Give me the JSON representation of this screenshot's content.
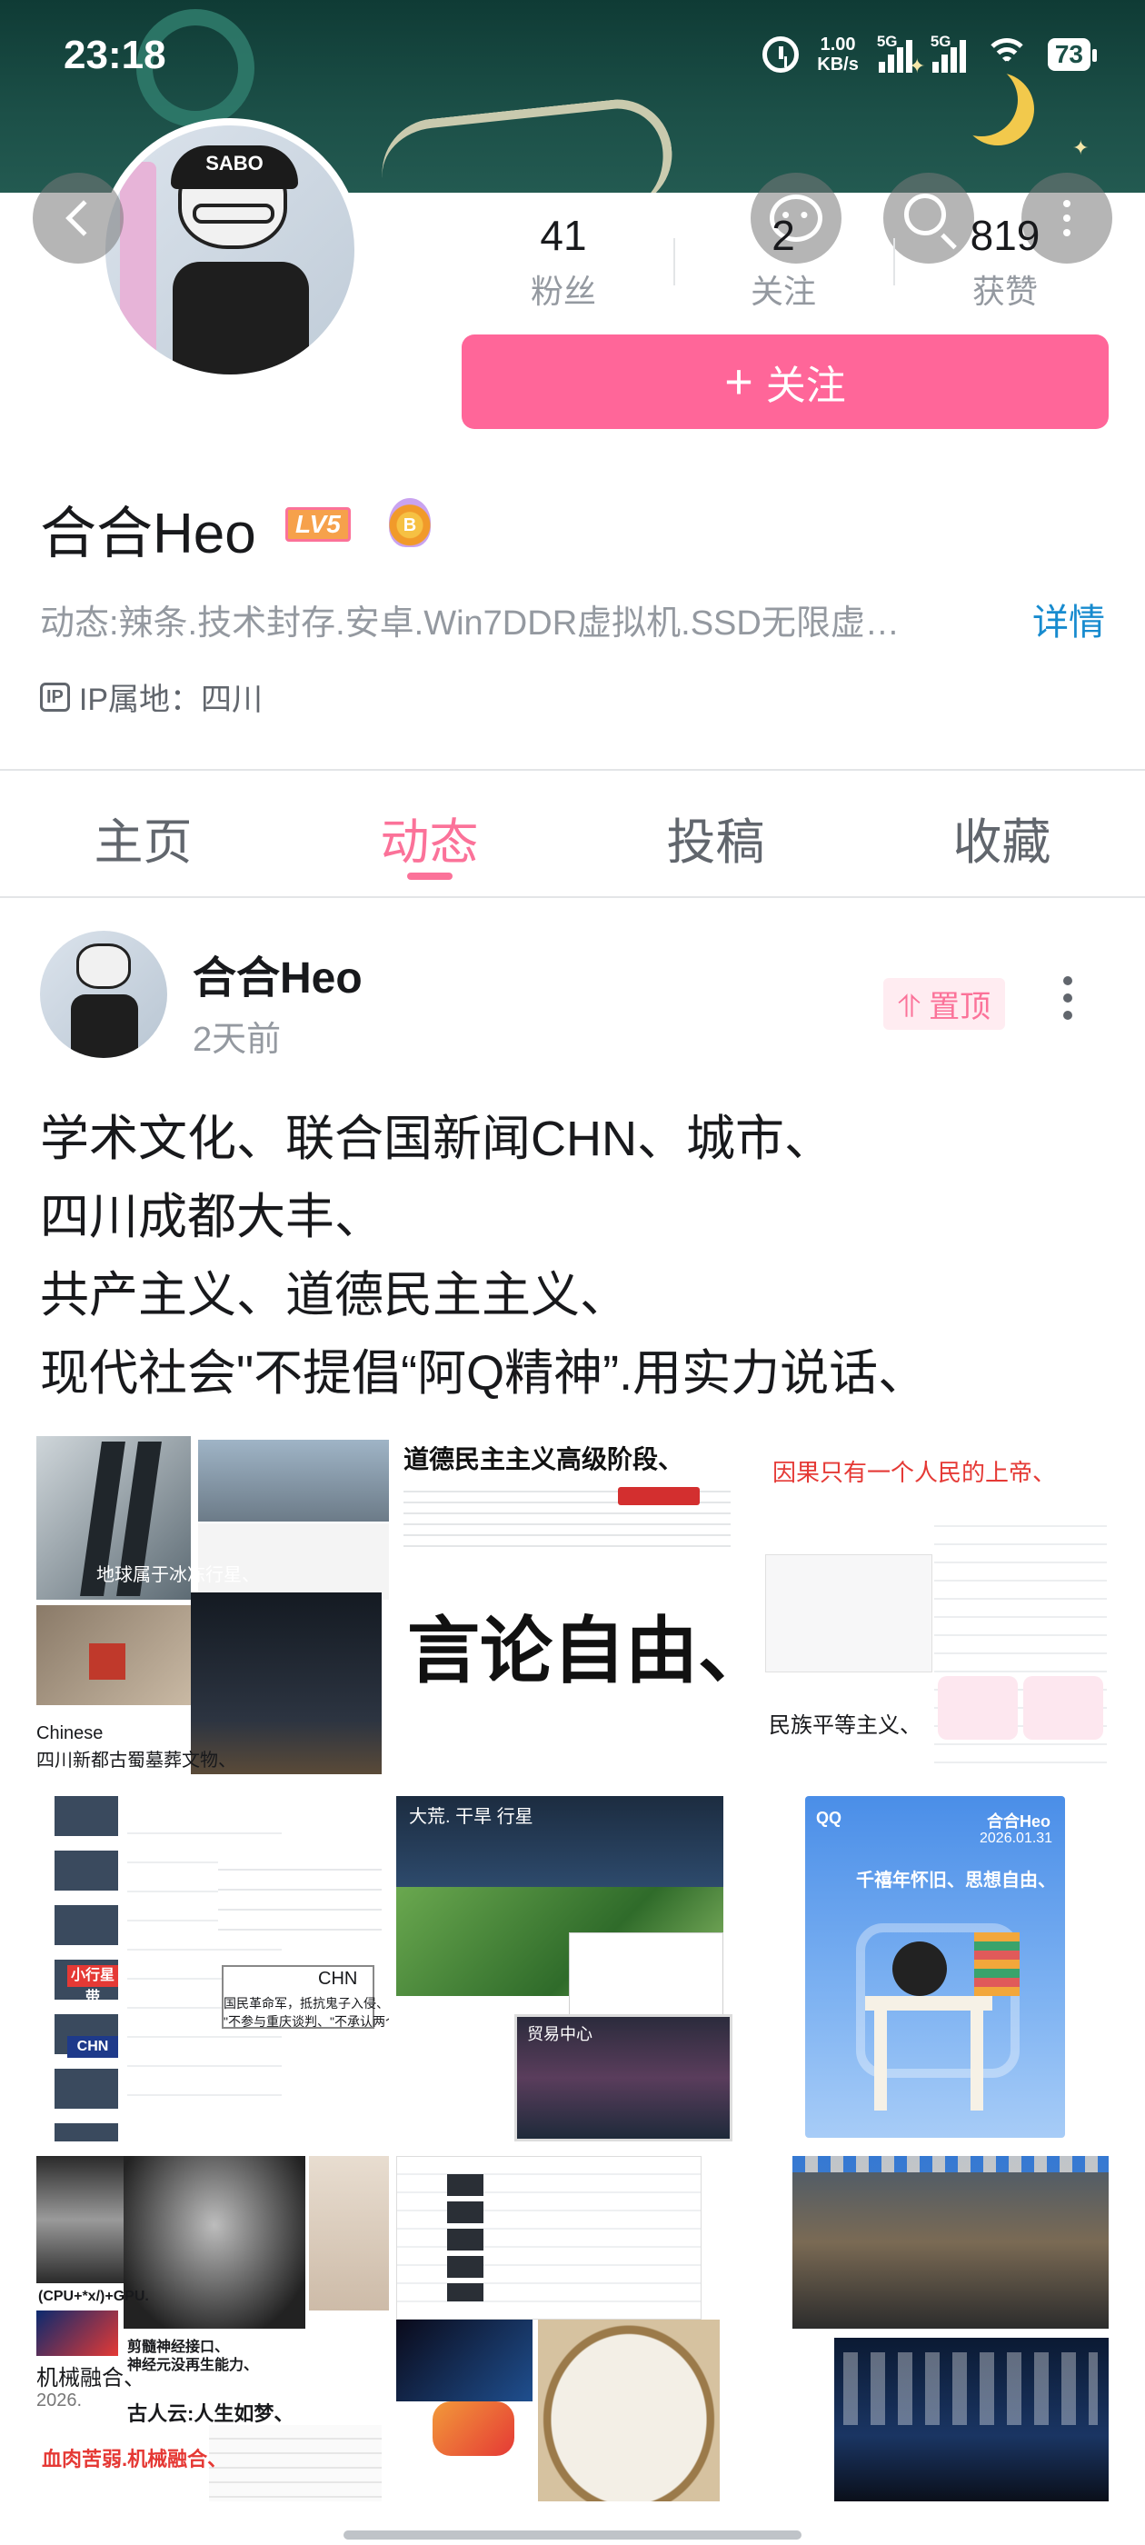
{
  "status_bar": {
    "time": "23:18",
    "net_speed_value": "1.00",
    "net_speed_unit": "KB/s",
    "sim1": "5G",
    "sim2": "5G",
    "battery": "73"
  },
  "header": {
    "stats": [
      {
        "value": "41",
        "label": "粉丝"
      },
      {
        "value": "2",
        "label": "关注"
      },
      {
        "value": "819",
        "label": "获赞"
      }
    ],
    "follow_label": "关注"
  },
  "profile": {
    "name": "合合Heo",
    "level_badge": "LV5",
    "signature": "动态:辣条.技术封存.安卓.Win7DDR虚拟机.SSD无限虚…",
    "detail_label": "详情",
    "ip_badge": "IP",
    "ip_location": "IP属地：四川"
  },
  "tabs": [
    {
      "label": "主页",
      "active": false
    },
    {
      "label": "动态",
      "active": true
    },
    {
      "label": "投稿",
      "active": false
    },
    {
      "label": "收藏",
      "active": false
    }
  ],
  "post": {
    "author": "合合Heo",
    "time": "2天前",
    "pinned_label": "置顶",
    "text_lines": [
      "学术文化、联合国新闻CHN、城市、",
      "四川成都大丰、",
      "共产主义、道德民主主义、",
      "现代社会\"不提倡“阿Q精神”.用实力说话、"
    ],
    "images": {
      "img1": {
        "caption1": "地球属于冰冻行星、",
        "caption2": "Chinese",
        "caption3": "四川新都古蜀墓葬文物、"
      },
      "img2": {
        "title": "道德民主主义高级阶段、",
        "big": "言论自由、"
      },
      "img3": {
        "title": "因果只有一个人民的上帝、",
        "footer": "民族平等主义、"
      },
      "img4": {
        "badge1": "小行星带",
        "badge2": "CHN",
        "label": "CHN",
        "line1": "国民革命军，抵抗鬼子入侵、",
        "line2": "\"不参与重庆谈判、\"不承认两个中国"
      },
      "img5": {
        "top": "大荒. 干旱 行星",
        "bottom": "贸易中心"
      },
      "img6": {
        "brand": "QQ",
        "name": "合合Heo",
        "date": "2026.01.31",
        "slogan": "千禧年怀旧、思想自由、"
      },
      "img7": {
        "tag": "(CPU+*x/)+GPU.",
        "l1": "机械融合、",
        "l2": "2026.",
        "l3": "古人云:人生如梦、",
        "l4": "血肉苦弱.机械融合、",
        "l5": "剪髓神经接口、",
        "l6": "神经元没再生能力、"
      },
      "img8": {},
      "img9": {}
    }
  },
  "colors": {
    "accent": "#fb7299",
    "follow_button": "#ff6699",
    "link": "#178bcf",
    "banner": "#1c5048"
  },
  "icons": [
    "back-icon",
    "message-icon",
    "search-icon",
    "more-icon",
    "alarm-icon",
    "wifi-icon",
    "ip-icon",
    "pin-icon"
  ]
}
